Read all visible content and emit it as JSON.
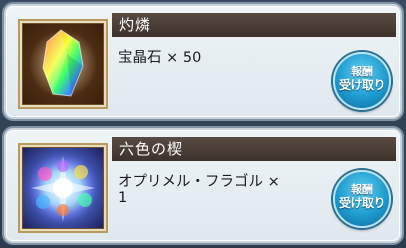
{
  "rewards": [
    {
      "name": "灼燐",
      "description": "宝晶石 × 50",
      "icon": "rainbow-crystal-icon",
      "button_line1": "報酬",
      "button_line2": "受け取り"
    },
    {
      "name": "六色の楔",
      "description": "オプリメル・フラゴル ×\n1",
      "icon": "six-color-wedge-icon",
      "button_line1": "報酬",
      "button_line2": "受け取り"
    }
  ],
  "colors": {
    "button": "#1f9bd0",
    "title_bar": "#4a3d36",
    "card": "#e6eef3"
  }
}
